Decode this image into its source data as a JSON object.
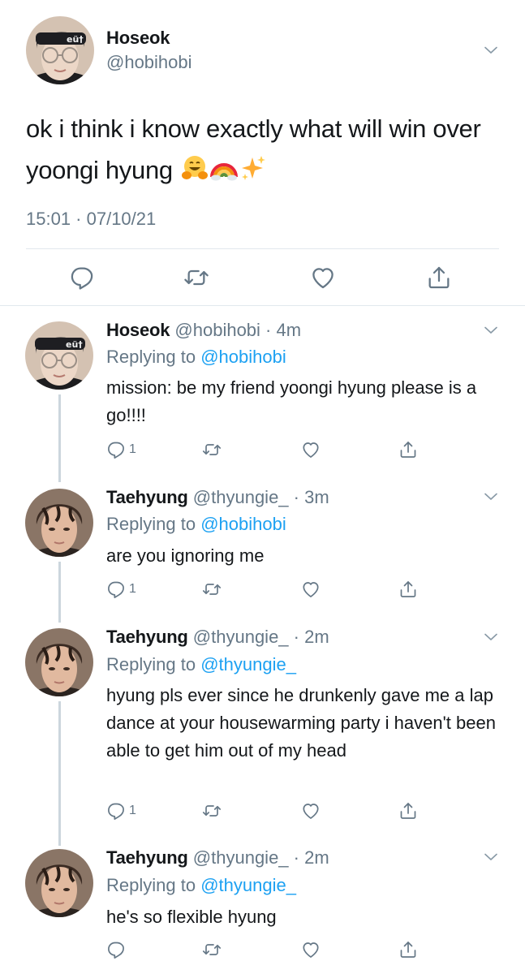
{
  "main_tweet": {
    "name": "Hoseok",
    "handle": "@hobihobi",
    "text": "ok i think i know exactly what will win over yoongi hyung",
    "emoji": [
      "hugging-face",
      "rainbow",
      "sparkles"
    ],
    "timestamp": "15:01 · 07/10/21"
  },
  "replies": [
    {
      "name": "Hoseok",
      "meta": "@hobihobi · 4m",
      "replying_prefix": "Replying to ",
      "replying_to": "@hobihobi",
      "text": "mission: be my friend yoongi hyung please is a go!!!!",
      "reply_count": "1",
      "avatar": "hoseok-avatar"
    },
    {
      "name": "Taehyung",
      "meta": "@thyungie_ · 3m",
      "replying_prefix": "Replying to ",
      "replying_to": "@hobihobi",
      "text": "are you ignoring me",
      "reply_count": "1",
      "avatar": "taehyung-avatar"
    },
    {
      "name": "Taehyung",
      "meta": "@thyungie_ · 2m",
      "replying_prefix": "Replying to ",
      "replying_to": "@thyungie_",
      "text": "hyung pls ever since he drunkenly gave me a lap dance at your housewarming party i haven't been able to get him out of my head",
      "reply_count": "1",
      "avatar": "taehyung-avatar"
    },
    {
      "name": "Taehyung",
      "meta": "@thyungie_ · 2m",
      "replying_prefix": "Replying to ",
      "replying_to": "@thyungie_",
      "text": "he's so flexible hyung",
      "reply_count": "",
      "avatar": "taehyung-avatar"
    }
  ],
  "colors": {
    "link": "#1da1f2",
    "secondary_text": "#657786",
    "divider": "#e1e8ed",
    "thread_line": "#ccd6dd"
  }
}
